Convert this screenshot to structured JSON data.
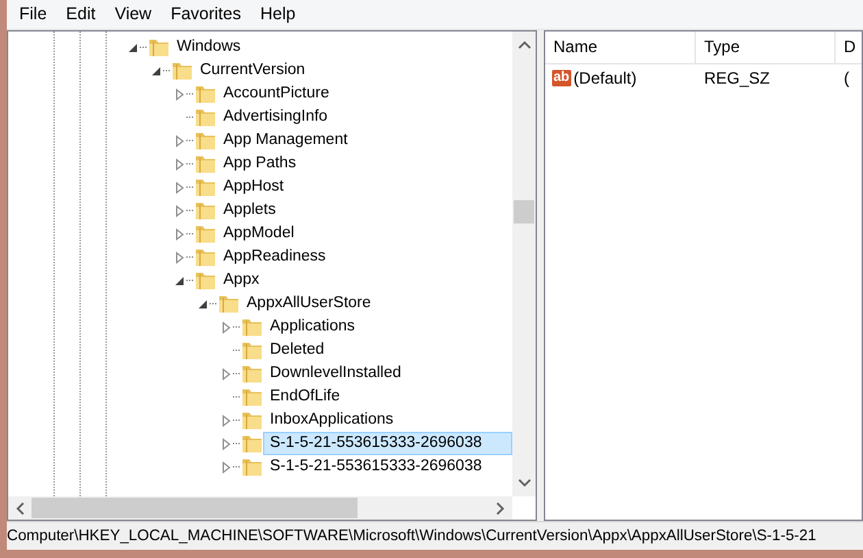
{
  "menu": [
    "File",
    "Edit",
    "View",
    "Favorites",
    "Help"
  ],
  "tree": [
    {
      "label": "Windows",
      "kind": "expanded",
      "selected": false,
      "children": [
        {
          "label": "CurrentVersion",
          "kind": "expanded",
          "selected": false,
          "children": [
            {
              "label": "AccountPicture",
              "kind": "collapsed",
              "selected": false
            },
            {
              "label": "AdvertisingInfo",
              "kind": "leaf",
              "selected": false
            },
            {
              "label": "App Management",
              "kind": "collapsed",
              "selected": false
            },
            {
              "label": "App Paths",
              "kind": "collapsed",
              "selected": false
            },
            {
              "label": "AppHost",
              "kind": "collapsed",
              "selected": false
            },
            {
              "label": "Applets",
              "kind": "collapsed",
              "selected": false
            },
            {
              "label": "AppModel",
              "kind": "collapsed",
              "selected": false
            },
            {
              "label": "AppReadiness",
              "kind": "collapsed",
              "selected": false
            },
            {
              "label": "Appx",
              "kind": "expanded",
              "selected": false,
              "children": [
                {
                  "label": "AppxAllUserStore",
                  "kind": "expanded",
                  "selected": false,
                  "children": [
                    {
                      "label": "Applications",
                      "kind": "collapsed",
                      "selected": false
                    },
                    {
                      "label": "Deleted",
                      "kind": "leaf",
                      "selected": false
                    },
                    {
                      "label": "DownlevelInstalled",
                      "kind": "collapsed",
                      "selected": false
                    },
                    {
                      "label": "EndOfLife",
                      "kind": "leaf",
                      "selected": false
                    },
                    {
                      "label": "InboxApplications",
                      "kind": "collapsed",
                      "selected": false
                    },
                    {
                      "label": "S-1-5-21-553615333-2696038",
                      "kind": "collapsed",
                      "selected": true
                    },
                    {
                      "label": "S-1-5-21-553615333-2696038",
                      "kind": "collapsed",
                      "selected": false
                    }
                  ]
                }
              ]
            }
          ]
        }
      ]
    }
  ],
  "values": {
    "columns": [
      "Name",
      "Type",
      "D"
    ],
    "rows": [
      {
        "icon_text": "ab",
        "name": "(Default)",
        "type": "REG_SZ",
        "column_3": "("
      }
    ]
  },
  "status_bar": "Computer\\HKEY_LOCAL_MACHINE\\SOFTWARE\\Microsoft\\Windows\\CurrentVersion\\Appx\\AppxAllUserStore\\S-1-5-21"
}
